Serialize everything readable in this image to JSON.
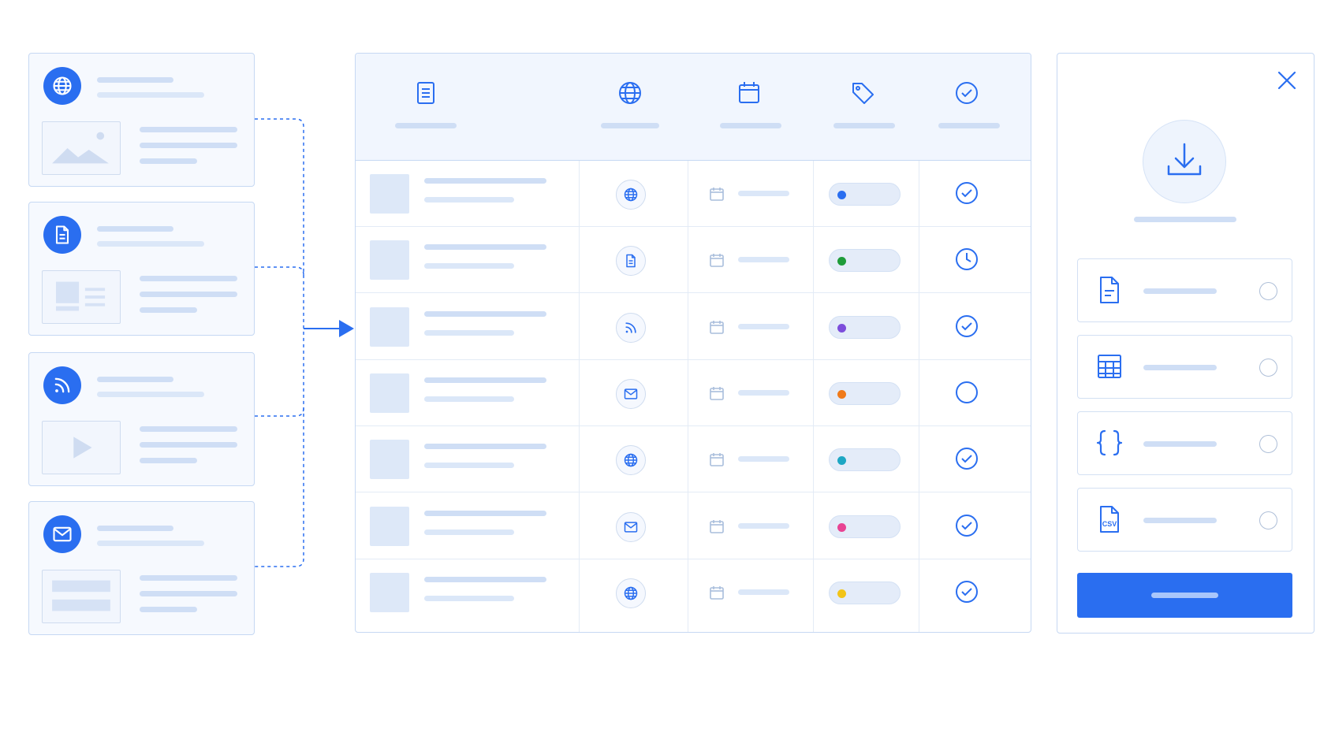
{
  "colors": {
    "accent": "#2a6ef0",
    "border": "#c6d8f3",
    "placeholder": "#cfdef5"
  },
  "sources": [
    {
      "icon": "globe-icon",
      "preview": "image-preview"
    },
    {
      "icon": "document-icon",
      "preview": "article-preview"
    },
    {
      "icon": "rss-icon",
      "preview": "video-preview"
    },
    {
      "icon": "mail-icon",
      "preview": "email-preview"
    }
  ],
  "table": {
    "columns": [
      "document-icon",
      "globe-icon",
      "calendar-icon",
      "tag-icon",
      "check-circle-icon"
    ],
    "rows": [
      {
        "type_icon": "globe-icon",
        "tag_color": "#2a6ef0",
        "status": "done"
      },
      {
        "type_icon": "document-icon",
        "tag_color": "#1e9c3a",
        "status": "pending"
      },
      {
        "type_icon": "rss-icon",
        "tag_color": "#7c4ddb",
        "status": "done"
      },
      {
        "type_icon": "mail-icon",
        "tag_color": "#f07a1a",
        "status": "empty"
      },
      {
        "type_icon": "globe-icon",
        "tag_color": "#1ea7c4",
        "status": "done"
      },
      {
        "type_icon": "mail-icon",
        "tag_color": "#e84393",
        "status": "done"
      },
      {
        "type_icon": "globe-icon",
        "tag_color": "#f2c418",
        "status": "done"
      }
    ]
  },
  "export_panel": {
    "icon": "download-icon",
    "formats": [
      {
        "icon": "text-file-icon",
        "selected": false
      },
      {
        "icon": "table-grid-icon",
        "selected": false
      },
      {
        "icon": "braces-icon",
        "selected": false
      },
      {
        "icon": "csv-file-icon",
        "selected": false,
        "badge": "CSV"
      }
    ]
  }
}
